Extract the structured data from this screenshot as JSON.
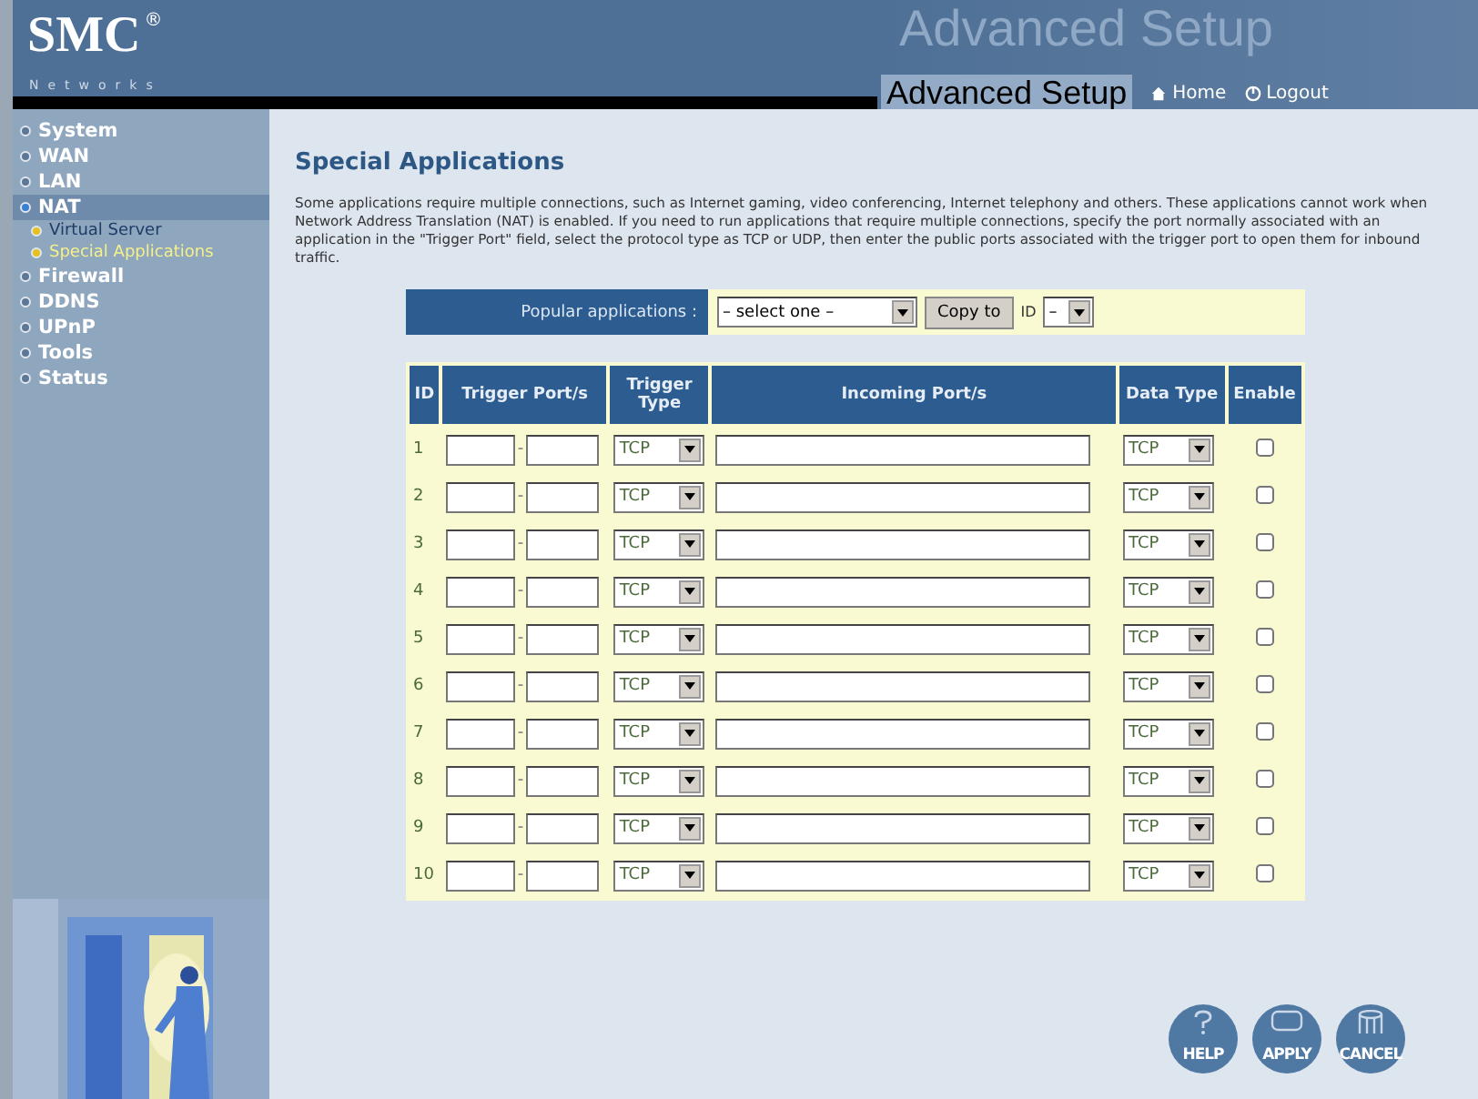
{
  "header": {
    "logo": "SMC",
    "logo_mark": "®",
    "logo_sub": "Networks",
    "watermark": "Advanced Setup",
    "title": "Advanced Setup",
    "links": [
      {
        "label": "Home",
        "kind": "home"
      },
      {
        "label": "Logout",
        "kind": "logout"
      }
    ]
  },
  "sidebar": {
    "items": [
      {
        "label": "System",
        "selected": false
      },
      {
        "label": "WAN",
        "selected": false
      },
      {
        "label": "LAN",
        "selected": false
      },
      {
        "label": "NAT",
        "selected": true,
        "children": [
          {
            "label": "Virtual Server",
            "selected": false
          },
          {
            "label": "Special Applications",
            "selected": true
          }
        ]
      },
      {
        "label": "Firewall",
        "selected": false
      },
      {
        "label": "DDNS",
        "selected": false
      },
      {
        "label": "UPnP",
        "selected": false
      },
      {
        "label": "Tools",
        "selected": false
      },
      {
        "label": "Status",
        "selected": false
      }
    ]
  },
  "page": {
    "title": "Special Applications",
    "description": "Some applications require multiple connections, such as Internet gaming, video conferencing, Internet telephony and others. These applications cannot work when Network Address Translation (NAT) is enabled. If you need to run applications that require multiple connections, specify the port normally associated with an application in the \"Trigger Port\" field, select the protocol type as TCP or UDP, then enter the public ports associated with the trigger port to open them for inbound traffic."
  },
  "popular": {
    "label": "Popular applications :",
    "select": "– select one –",
    "button": "Copy to",
    "id_label": "ID",
    "id_select": "–"
  },
  "table": {
    "columns": [
      "ID",
      "Trigger Port/s",
      "Trigger Type",
      "Incoming Port/s",
      "Data Type",
      "Enable"
    ],
    "rows": [
      {
        "id": "1",
        "separator": "-",
        "trigger_type": "TCP",
        "data_type": "TCP",
        "enable": false
      },
      {
        "id": "2",
        "separator": "-",
        "trigger_type": "TCP",
        "data_type": "TCP",
        "enable": false
      },
      {
        "id": "3",
        "separator": "-",
        "trigger_type": "TCP",
        "data_type": "TCP",
        "enable": false
      },
      {
        "id": "4",
        "separator": "-",
        "trigger_type": "TCP",
        "data_type": "TCP",
        "enable": false
      },
      {
        "id": "5",
        "separator": "-",
        "trigger_type": "TCP",
        "data_type": "TCP",
        "enable": false
      },
      {
        "id": "6",
        "separator": "-",
        "trigger_type": "TCP",
        "data_type": "TCP",
        "enable": false
      },
      {
        "id": "7",
        "separator": "-",
        "trigger_type": "TCP",
        "data_type": "TCP",
        "enable": false
      },
      {
        "id": "8",
        "separator": "-",
        "trigger_type": "TCP",
        "data_type": "TCP",
        "enable": false
      },
      {
        "id": "9",
        "separator": "-",
        "trigger_type": "TCP",
        "data_type": "TCP",
        "enable": false
      },
      {
        "id": "10",
        "separator": "-",
        "trigger_type": "TCP",
        "data_type": "TCP",
        "enable": false
      }
    ]
  },
  "buttons": [
    {
      "label": "HELP",
      "kind": "help"
    },
    {
      "label": "APPLY",
      "kind": "apply"
    },
    {
      "label": "CANCEL",
      "kind": "cancel"
    }
  ]
}
